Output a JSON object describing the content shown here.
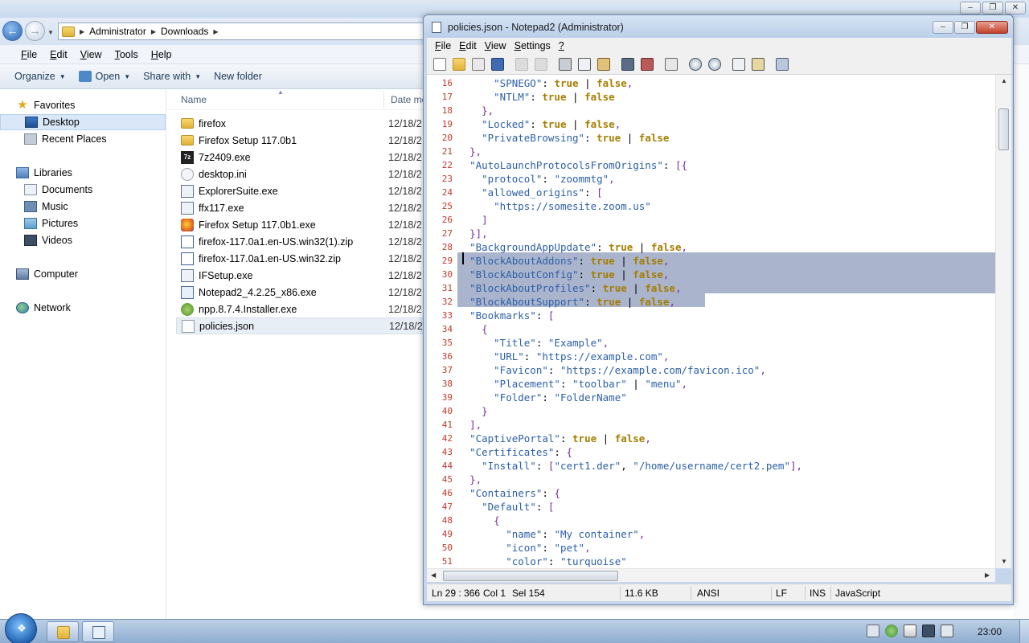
{
  "explorer": {
    "breadcrumb": [
      "Administrator",
      "Downloads"
    ],
    "menu": [
      {
        "first": "F",
        "rest": "ile"
      },
      {
        "first": "E",
        "rest": "dit"
      },
      {
        "first": "V",
        "rest": "iew"
      },
      {
        "first": "T",
        "rest": "ools"
      },
      {
        "first": "H",
        "rest": "elp"
      }
    ],
    "toolbar": {
      "organize": "Organize",
      "open": "Open",
      "share": "Share with",
      "new_folder": "New folder"
    },
    "nav": {
      "favorites": "Favorites",
      "desktop": "Desktop",
      "recent": "Recent Places",
      "libraries": "Libraries",
      "documents": "Documents",
      "music": "Music",
      "pictures": "Pictures",
      "videos": "Videos",
      "computer": "Computer",
      "network": "Network"
    },
    "columns": {
      "name": "Name",
      "date": "Date mo"
    },
    "files": [
      {
        "name": "firefox",
        "date": "12/18/2",
        "icon": "folder-icon"
      },
      {
        "name": "Firefox Setup 117.0b1",
        "date": "12/18/2",
        "icon": "folder-icon"
      },
      {
        "name": "7z2409.exe",
        "date": "12/18/2",
        "icon": "7zip-icon"
      },
      {
        "name": "desktop.ini",
        "date": "12/18/2",
        "icon": "settings-file-icon"
      },
      {
        "name": "ExplorerSuite.exe",
        "date": "12/18/2",
        "icon": "exe-icon"
      },
      {
        "name": "ffx117.exe",
        "date": "12/18/2",
        "icon": "exe-icon"
      },
      {
        "name": "Firefox Setup 117.0b1.exe",
        "date": "12/18/2",
        "icon": "firefox-icon"
      },
      {
        "name": "firefox-117.0a1.en-US.win32(1).zip",
        "date": "12/18/2",
        "icon": "zip-icon"
      },
      {
        "name": "firefox-117.0a1.en-US.win32.zip",
        "date": "12/18/2",
        "icon": "zip-icon"
      },
      {
        "name": "IFSetup.exe",
        "date": "12/18/2",
        "icon": "exe-icon"
      },
      {
        "name": "Notepad2_4.2.25_x86.exe",
        "date": "12/18/2",
        "icon": "notepad-icon"
      },
      {
        "name": "npp.8.7.4.Installer.exe",
        "date": "12/18/2",
        "icon": "npp-icon"
      },
      {
        "name": "policies.json",
        "date": "12/18/2",
        "icon": "json-file-icon"
      }
    ]
  },
  "notepad": {
    "title": "policies.json - Notepad2 (Administrator)",
    "menu": [
      {
        "first": "F",
        "rest": "ile"
      },
      {
        "first": "E",
        "rest": "dit"
      },
      {
        "first": "V",
        "rest": "iew"
      },
      {
        "first": "S",
        "rest": "ettings"
      },
      {
        "first": "?",
        "rest": ""
      }
    ],
    "code_lines": [
      {
        "n": "16",
        "segs": [
          [
            "",
            "      "
          ],
          [
            "k",
            "\"SPNEGO\""
          ],
          [
            "",
            ": "
          ],
          [
            "b",
            "true"
          ],
          [
            "",
            " | "
          ],
          [
            "b",
            "false"
          ],
          [
            "p",
            ","
          ]
        ]
      },
      {
        "n": "17",
        "segs": [
          [
            "",
            "      "
          ],
          [
            "k",
            "\"NTLM\""
          ],
          [
            "",
            ": "
          ],
          [
            "b",
            "true"
          ],
          [
            "",
            " | "
          ],
          [
            "b",
            "false"
          ]
        ]
      },
      {
        "n": "18",
        "segs": [
          [
            "",
            "    "
          ],
          [
            "p",
            "},"
          ]
        ]
      },
      {
        "n": "19",
        "segs": [
          [
            "",
            "    "
          ],
          [
            "k",
            "\"Locked\""
          ],
          [
            "",
            ": "
          ],
          [
            "b",
            "true"
          ],
          [
            "",
            " | "
          ],
          [
            "b",
            "false"
          ],
          [
            "p",
            ","
          ]
        ]
      },
      {
        "n": "20",
        "segs": [
          [
            "",
            "    "
          ],
          [
            "k",
            "\"PrivateBrowsing\""
          ],
          [
            "",
            ": "
          ],
          [
            "b",
            "true"
          ],
          [
            "",
            " | "
          ],
          [
            "b",
            "false"
          ]
        ]
      },
      {
        "n": "21",
        "segs": [
          [
            "",
            "  "
          ],
          [
            "p",
            "},"
          ]
        ]
      },
      {
        "n": "22",
        "segs": [
          [
            "",
            "  "
          ],
          [
            "k",
            "\"AutoLaunchProtocolsFromOrigins\""
          ],
          [
            "",
            ": "
          ],
          [
            "p",
            "[{"
          ]
        ]
      },
      {
        "n": "23",
        "segs": [
          [
            "",
            "    "
          ],
          [
            "k",
            "\"protocol\""
          ],
          [
            "",
            ": "
          ],
          [
            "s",
            "\"zoommtg\""
          ],
          [
            "p",
            ","
          ]
        ]
      },
      {
        "n": "24",
        "segs": [
          [
            "",
            "    "
          ],
          [
            "k",
            "\"allowed_origins\""
          ],
          [
            "",
            ": "
          ],
          [
            "p",
            "["
          ]
        ]
      },
      {
        "n": "25",
        "segs": [
          [
            "",
            "      "
          ],
          [
            "s",
            "\"https://somesite.zoom.us\""
          ]
        ]
      },
      {
        "n": "26",
        "segs": [
          [
            "",
            "    "
          ],
          [
            "p",
            "]"
          ]
        ]
      },
      {
        "n": "27",
        "segs": [
          [
            "",
            "  "
          ],
          [
            "p",
            "}],"
          ]
        ]
      },
      {
        "n": "28",
        "segs": [
          [
            "",
            "  "
          ],
          [
            "k",
            "\"BackgroundAppUpdate\""
          ],
          [
            "",
            ": "
          ],
          [
            "b",
            "true"
          ],
          [
            "",
            " | "
          ],
          [
            "b",
            "false"
          ],
          [
            "p",
            ","
          ]
        ]
      },
      {
        "n": "29",
        "segs": [
          [
            "",
            "  "
          ],
          [
            "k",
            "\"BlockAboutAddons\""
          ],
          [
            "",
            ": "
          ],
          [
            "b",
            "true"
          ],
          [
            "",
            " | "
          ],
          [
            "b",
            "false"
          ],
          [
            "p",
            ","
          ]
        ]
      },
      {
        "n": "30",
        "segs": [
          [
            "",
            "  "
          ],
          [
            "k",
            "\"BlockAboutConfig\""
          ],
          [
            "",
            ": "
          ],
          [
            "b",
            "true"
          ],
          [
            "",
            " | "
          ],
          [
            "b",
            "false"
          ],
          [
            "p",
            ","
          ]
        ]
      },
      {
        "n": "31",
        "segs": [
          [
            "",
            "  "
          ],
          [
            "k",
            "\"BlockAboutProfiles\""
          ],
          [
            "",
            ": "
          ],
          [
            "b",
            "true"
          ],
          [
            "",
            " | "
          ],
          [
            "b",
            "false"
          ],
          [
            "p",
            ","
          ]
        ]
      },
      {
        "n": "32",
        "segs": [
          [
            "",
            "  "
          ],
          [
            "k",
            "\"BlockAboutSupport\""
          ],
          [
            "",
            ": "
          ],
          [
            "b",
            "true"
          ],
          [
            "",
            " | "
          ],
          [
            "b",
            "false"
          ],
          [
            "p",
            ","
          ]
        ]
      },
      {
        "n": "33",
        "segs": [
          [
            "",
            "  "
          ],
          [
            "k",
            "\"Bookmarks\""
          ],
          [
            "",
            ": "
          ],
          [
            "p",
            "["
          ]
        ]
      },
      {
        "n": "34",
        "segs": [
          [
            "",
            "    "
          ],
          [
            "p",
            "{"
          ]
        ]
      },
      {
        "n": "35",
        "segs": [
          [
            "",
            "      "
          ],
          [
            "k",
            "\"Title\""
          ],
          [
            "",
            ": "
          ],
          [
            "s",
            "\"Example\""
          ],
          [
            "p",
            ","
          ]
        ]
      },
      {
        "n": "36",
        "segs": [
          [
            "",
            "      "
          ],
          [
            "k",
            "\"URL\""
          ],
          [
            "",
            ": "
          ],
          [
            "s",
            "\"https://example.com\""
          ],
          [
            "p",
            ","
          ]
        ]
      },
      {
        "n": "37",
        "segs": [
          [
            "",
            "      "
          ],
          [
            "k",
            "\"Favicon\""
          ],
          [
            "",
            ": "
          ],
          [
            "s",
            "\"https://example.com/favicon.ico\""
          ],
          [
            "p",
            ","
          ]
        ]
      },
      {
        "n": "38",
        "segs": [
          [
            "",
            "      "
          ],
          [
            "k",
            "\"Placement\""
          ],
          [
            "",
            ": "
          ],
          [
            "s",
            "\"toolbar\""
          ],
          [
            "",
            " | "
          ],
          [
            "s",
            "\"menu\""
          ],
          [
            "p",
            ","
          ]
        ]
      },
      {
        "n": "39",
        "segs": [
          [
            "",
            "      "
          ],
          [
            "k",
            "\"Folder\""
          ],
          [
            "",
            ": "
          ],
          [
            "s",
            "\"FolderName\""
          ]
        ]
      },
      {
        "n": "40",
        "segs": [
          [
            "",
            "    "
          ],
          [
            "p",
            "}"
          ]
        ]
      },
      {
        "n": "41",
        "segs": [
          [
            "",
            "  "
          ],
          [
            "p",
            "],"
          ]
        ]
      },
      {
        "n": "42",
        "segs": [
          [
            "",
            "  "
          ],
          [
            "k",
            "\"CaptivePortal\""
          ],
          [
            "",
            ": "
          ],
          [
            "b",
            "true"
          ],
          [
            "",
            " | "
          ],
          [
            "b",
            "false"
          ],
          [
            "p",
            ","
          ]
        ]
      },
      {
        "n": "43",
        "segs": [
          [
            "",
            "  "
          ],
          [
            "k",
            "\"Certificates\""
          ],
          [
            "",
            ": "
          ],
          [
            "p",
            "{"
          ]
        ]
      },
      {
        "n": "44",
        "segs": [
          [
            "",
            "    "
          ],
          [
            "k",
            "\"Install\""
          ],
          [
            "",
            ": "
          ],
          [
            "p",
            "["
          ],
          [
            "s",
            "\"cert1.der\""
          ],
          [
            "",
            ", "
          ],
          [
            "s",
            "\"/home/username/cert2.pem\""
          ],
          [
            "p",
            "],"
          ]
        ]
      },
      {
        "n": "45",
        "segs": [
          [
            "",
            "  "
          ],
          [
            "p",
            "},"
          ]
        ]
      },
      {
        "n": "46",
        "segs": [
          [
            "",
            "  "
          ],
          [
            "k",
            "\"Containers\""
          ],
          [
            "",
            ": "
          ],
          [
            "p",
            "{"
          ]
        ]
      },
      {
        "n": "47",
        "segs": [
          [
            "",
            "    "
          ],
          [
            "k",
            "\"Default\""
          ],
          [
            "",
            ": "
          ],
          [
            "p",
            "["
          ]
        ]
      },
      {
        "n": "48",
        "segs": [
          [
            "",
            "      "
          ],
          [
            "p",
            "{"
          ]
        ]
      },
      {
        "n": "49",
        "segs": [
          [
            "",
            "        "
          ],
          [
            "k",
            "\"name\""
          ],
          [
            "",
            ": "
          ],
          [
            "s",
            "\"My container\""
          ],
          [
            "p",
            ","
          ]
        ]
      },
      {
        "n": "50",
        "segs": [
          [
            "",
            "        "
          ],
          [
            "k",
            "\"icon\""
          ],
          [
            "",
            ": "
          ],
          [
            "s",
            "\"pet\""
          ],
          [
            "p",
            ","
          ]
        ]
      },
      {
        "n": "51",
        "segs": [
          [
            "",
            "        "
          ],
          [
            "k",
            "\"color\""
          ],
          [
            "",
            ": "
          ],
          [
            "s",
            "\"turquoise\""
          ]
        ]
      }
    ],
    "status": {
      "position": "Ln 29 : 366",
      "col": "Col 1",
      "sel": "Sel 154",
      "size": "11.6 KB",
      "encoding": "ANSI",
      "eol": "LF",
      "mode": "INS",
      "lexer": "JavaScript"
    }
  },
  "taskbar": {
    "clock": "23:00"
  },
  "colors": {
    "line_numbers": "#c0392b",
    "selection": "#aab4cc",
    "keyword": "#a67d00",
    "string": "#2c5fa8"
  }
}
